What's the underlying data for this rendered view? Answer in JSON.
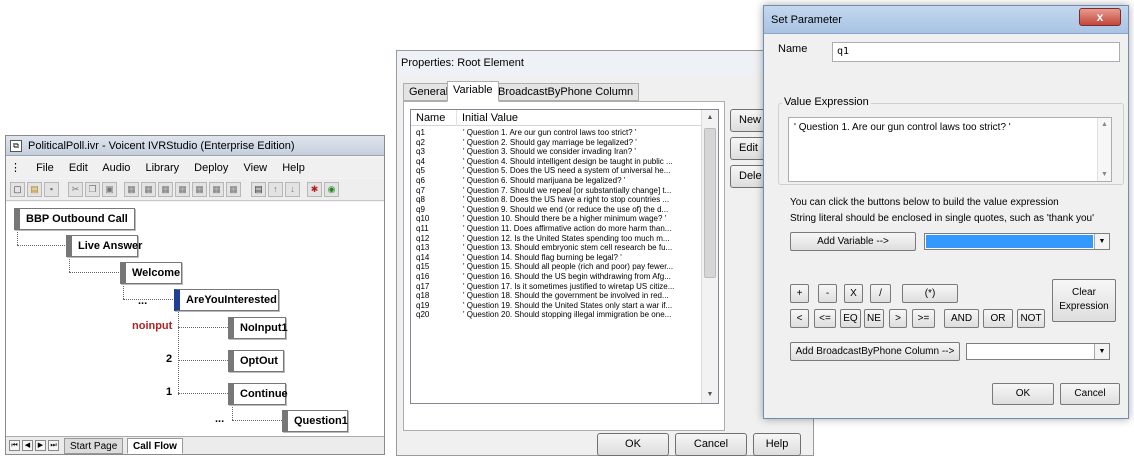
{
  "ivr": {
    "title": "PoliticalPoll.ivr - Voicent IVRStudio (Enterprise Edition)",
    "menu": [
      "File",
      "Edit",
      "Audio",
      "Library",
      "Deploy",
      "View",
      "Help"
    ],
    "nodes": {
      "bbp_outbound_call": "BBP Outbound Call",
      "live_answer": "Live Answer",
      "welcome": "Welcome",
      "are_you_interested": "AreYouInterested",
      "noinput1": "NoInput1",
      "optout": "OptOut",
      "continue": "Continue",
      "question1": "Question1"
    },
    "edge_labels": {
      "dots1": "...",
      "noinput": "noinput",
      "two": "2",
      "one": "1",
      "dots2": "..."
    },
    "tabs": [
      "Start Page",
      "Call Flow"
    ],
    "active_tab": "Call Flow"
  },
  "properties": {
    "title": "Properties: Root Element",
    "tabs": [
      "General",
      "Variable",
      "BroadcastByPhone Column"
    ],
    "active_tab": "Variable",
    "columns": [
      "Name",
      "Initial Value"
    ],
    "rows": [
      {
        "name": "q1",
        "value": "' Question 1. Are our gun control laws too strict?  '"
      },
      {
        "name": "q2",
        "value": "' Question 2. Should gay marriage be legalized?  '"
      },
      {
        "name": "q3",
        "value": "' Question 3. Should we consider invading Iran?  '"
      },
      {
        "name": "q4",
        "value": "' Question 4. Should intelligent design be taught in public ..."
      },
      {
        "name": "q5",
        "value": "' Question 5. Does the US need a system of universal he..."
      },
      {
        "name": "q6",
        "value": "' Question 6. Should marijuana be legalized?  '"
      },
      {
        "name": "q7",
        "value": "' Question 7. Should we repeal [or substantially change] t..."
      },
      {
        "name": "q8",
        "value": "' Question 8. Does the US have a right to stop countries ..."
      },
      {
        "name": "q9",
        "value": "' Question 9. Should we end (or reduce the use of) the d..."
      },
      {
        "name": "q10",
        "value": "' Question 10. Should there be a higher minimum wage?  '"
      },
      {
        "name": "q11",
        "value": "' Question 11. Does affirmative action do more harm than..."
      },
      {
        "name": "q12",
        "value": "' Question 12. Is the United States spending too much m..."
      },
      {
        "name": "q13",
        "value": "' Question 13. Should embryonic stem cell research be fu..."
      },
      {
        "name": "q14",
        "value": "' Question 14. Should flag burning be legal?  '"
      },
      {
        "name": "q15",
        "value": "' Question 15. Should all people (rich and poor) pay fewer..."
      },
      {
        "name": "q16",
        "value": "' Question 16. Should the US begin withdrawing from Afg..."
      },
      {
        "name": "q17",
        "value": "' Question 17. Is it sometimes justified to wiretap US citize..."
      },
      {
        "name": "q18",
        "value": "' Question 18. Should the government be involved in red..."
      },
      {
        "name": "q19",
        "value": "' Question 19. Should the United States only start a war if..."
      },
      {
        "name": "q20",
        "value": "' Question 20. Should stopping illegal immigration be one..."
      }
    ],
    "side_buttons": [
      "New",
      "Edit",
      "Dele"
    ],
    "buttons": {
      "ok": "OK",
      "cancel": "Cancel",
      "help": "Help"
    }
  },
  "set_parameter": {
    "title": "Set Parameter",
    "close": "x",
    "name_label": "Name",
    "name_value": "q1",
    "group_label": "Value Expression",
    "expression": "' Question 1. Are our gun control laws too strict?  '",
    "hint1": "You can click the buttons below to build the value expression",
    "hint2": "String literal should be enclosed in single quotes, such as 'thank you'",
    "add_variable": "Add Variable -->",
    "ops_row1": [
      "+",
      "-",
      "X",
      "/",
      "(*)"
    ],
    "ops_row2": [
      "<",
      "<=",
      "EQ",
      "NE",
      ">",
      ">=",
      "AND",
      "OR",
      "NOT"
    ],
    "clear_expression": "Clear Expression",
    "add_column": "Add BroadcastByPhone Column -->",
    "ok": "OK",
    "cancel": "Cancel",
    "variable_combo_color": "#3399ff"
  }
}
